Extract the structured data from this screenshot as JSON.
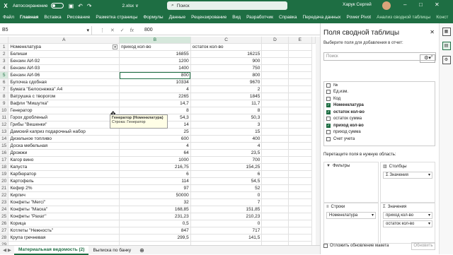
{
  "titlebar": {
    "logo": "X",
    "autosave_label": "Автосохранение",
    "filename": "2.xlsx ∨",
    "search_placeholder": "Поиск",
    "user": "Харук Сергей"
  },
  "ribbon": {
    "tabs": [
      "Файл",
      "Главная",
      "Вставка",
      "Рисование",
      "Разметка страницы",
      "Формулы",
      "Данные",
      "Рецензирование",
      "Вид",
      "Разработчик",
      "Справка",
      "Передача данных",
      "Power Pivot",
      "Анализ сводной таблицы",
      "Конст"
    ],
    "active_tab": "Главная"
  },
  "formula_bar": {
    "cell_ref": "B5",
    "value": "800"
  },
  "grid": {
    "columns": [
      "A",
      "B",
      "C",
      "D",
      "E"
    ],
    "selected_column": "B",
    "selected_row": 5,
    "rows": [
      {
        "n": 1,
        "a": "Номенклатура",
        "b": "приход кол-во",
        "c": "остаток кол-во"
      },
      {
        "n": 2,
        "a": "Белиши",
        "b": "16855",
        "c": "16215"
      },
      {
        "n": 3,
        "a": "Бензин АИ-92",
        "b": "1200",
        "c": "900"
      },
      {
        "n": 4,
        "a": "Бензин АИ-93",
        "b": "1400",
        "c": "750"
      },
      {
        "n": 5,
        "a": "Бензин АИ-96",
        "b": "800",
        "c": "800"
      },
      {
        "n": 6,
        "a": "Булочка сдобная",
        "b": "10334",
        "c": "9670"
      },
      {
        "n": 7,
        "a": "Бумага \"Белоснежка\" А4",
        "b": "4",
        "c": "2"
      },
      {
        "n": 8,
        "a": "Ватрушка с творогом",
        "b": "2265",
        "c": "1845"
      },
      {
        "n": 9,
        "a": "Вафли \"Мишутка\"",
        "b": "14,7",
        "c": "11,7"
      },
      {
        "n": 10,
        "a": "Генератор",
        "b": "8",
        "c": "8"
      },
      {
        "n": 11,
        "a": "Горох дробленый",
        "b": "54,3",
        "c": "50,3"
      },
      {
        "n": 12,
        "a": "Грибы \"Вешенки\"",
        "b": "14",
        "c": "3"
      },
      {
        "n": 13,
        "a": "Дамский каприз подарочный набор",
        "b": "25",
        "c": "15"
      },
      {
        "n": 14,
        "a": "Дизельное топливо",
        "b": "600",
        "c": "400"
      },
      {
        "n": 15,
        "a": "Доска мебельная",
        "b": "4",
        "c": "4"
      },
      {
        "n": 16,
        "a": "Дрожжи",
        "b": "64",
        "c": "23,5"
      },
      {
        "n": 17,
        "a": "Кагор вино",
        "b": "1000",
        "c": "700"
      },
      {
        "n": 18,
        "a": "Капуста",
        "b": "216,75",
        "c": "154,25"
      },
      {
        "n": 19,
        "a": "Карбюратор",
        "b": "6",
        "c": "6"
      },
      {
        "n": 20,
        "a": "Картофель",
        "b": "114",
        "c": "54,5"
      },
      {
        "n": 21,
        "a": "Кефир 2%",
        "b": "97",
        "c": "52"
      },
      {
        "n": 22,
        "a": "Кирпич",
        "b": "50000",
        "c": "0"
      },
      {
        "n": 23,
        "a": "Конфеты \"Merci\"",
        "b": "32",
        "c": "7"
      },
      {
        "n": 24,
        "a": "Конфеты \"Маска\"",
        "b": "168,85",
        "c": "151,85"
      },
      {
        "n": 25,
        "a": "Конфеты \"Рахат\"",
        "b": "231,23",
        "c": "210,23"
      },
      {
        "n": 26,
        "a": "Корица",
        "b": "0,5",
        "c": "0"
      },
      {
        "n": 27,
        "a": "Котлеты \"Нежность\"",
        "b": "847",
        "c": "717"
      },
      {
        "n": 28,
        "a": "Крупа гречневая",
        "b": "299,5",
        "c": "141,5"
      },
      {
        "n": 29,
        "a": "",
        "b": "",
        "c": ""
      }
    ]
  },
  "tooltip": {
    "line1": "Генератор (Номенклатура)",
    "line2": "Строка: Генератор"
  },
  "sheet_tabs": {
    "tabs": [
      "Материальная ведомость (2)",
      "Выписка по банку"
    ],
    "active": "Материальная ведомость (2)",
    "nav": "◀ ▶"
  },
  "pivot_panel": {
    "title": "Поля сводной таблицы",
    "hint": "Выберите поля для добавления в отчет:",
    "search_placeholder": "Поиск",
    "fields": [
      {
        "label": "№",
        "checked": false
      },
      {
        "label": "Ед.изм.",
        "checked": false
      },
      {
        "label": "Код",
        "checked": false
      },
      {
        "label": "Номенклатура",
        "checked": true
      },
      {
        "label": "остаток кол-во",
        "checked": true
      },
      {
        "label": "остаток сумма",
        "checked": false
      },
      {
        "label": "приход кол-во",
        "checked": true
      },
      {
        "label": "приход сумма",
        "checked": false
      },
      {
        "label": "Счет учета",
        "checked": false
      }
    ],
    "drag_hint": "Перетащите поля в нужную область:",
    "areas": {
      "filters": {
        "label": "Фильтры",
        "items": []
      },
      "columns": {
        "label": "Столбцы",
        "items": [
          "Σ Значения"
        ]
      },
      "rows": {
        "label": "Строки",
        "items": [
          "Номенклатура"
        ]
      },
      "values": {
        "label": "Значения",
        "items": [
          "приход кол-во",
          "остаток кол-во"
        ]
      }
    },
    "defer_label": "Отложить обновление макета",
    "update_label": "Обновить"
  }
}
